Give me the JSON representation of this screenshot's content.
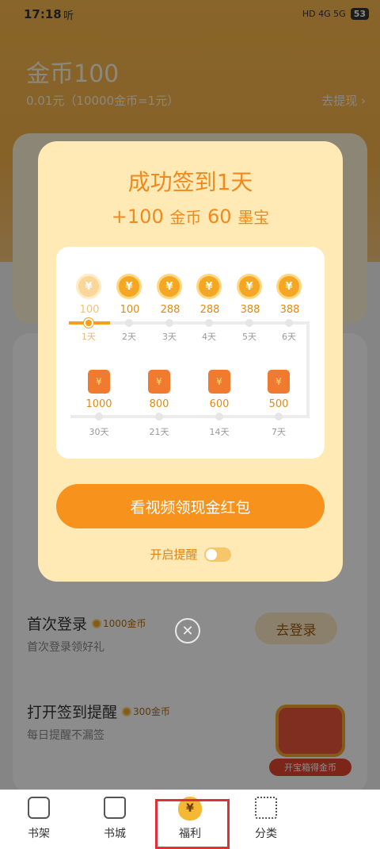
{
  "status": {
    "time": "17:18",
    "app_indicator": "听",
    "battery": "53",
    "signals": "HD 4G 5G"
  },
  "wallet": {
    "title": "金币100",
    "rate": "0.01元（10000金币=1元）",
    "withdraw": "去提现 ›"
  },
  "tasks": [
    {
      "title": "首次登录",
      "reward": "1000金币",
      "sub": "首次登录领好礼",
      "button": "去登录"
    },
    {
      "title": "打开签到提醒",
      "reward": "300金币",
      "sub": "每日提醒不漏签"
    }
  ],
  "chest": {
    "label": "开宝箱得金币",
    "icon": "treasure-chest-icon"
  },
  "dialog": {
    "title": "成功签到1天",
    "reward_coins_num": "+100",
    "reward_coins_unit": "金币",
    "reward_ink_num": "60",
    "reward_ink_unit": "墨宝",
    "coin_glyph": "¥",
    "row1": [
      {
        "value": "100",
        "day": "1天"
      },
      {
        "value": "100",
        "day": "2天"
      },
      {
        "value": "288",
        "day": "3天"
      },
      {
        "value": "288",
        "day": "4天"
      },
      {
        "value": "388",
        "day": "5天"
      },
      {
        "value": "388",
        "day": "6天"
      }
    ],
    "row2": [
      {
        "value": "1000",
        "day": "30天"
      },
      {
        "value": "800",
        "day": "21天"
      },
      {
        "value": "600",
        "day": "14天"
      },
      {
        "value": "500",
        "day": "7天"
      }
    ],
    "main_button": "看视频领现金红包",
    "remind_label": "开启提醒",
    "remind_on": false
  },
  "tabs": [
    {
      "label": "书架",
      "icon": "bookshelf-icon"
    },
    {
      "label": "书城",
      "icon": "bookstore-icon"
    },
    {
      "label": "福利",
      "icon": "money-bag-icon"
    },
    {
      "label": "分类",
      "icon": "category-icon"
    }
  ],
  "colors": {
    "accent": "#f7921c",
    "dialog_bg": "#ffeab5",
    "highlight_frame": "#e0303a"
  }
}
